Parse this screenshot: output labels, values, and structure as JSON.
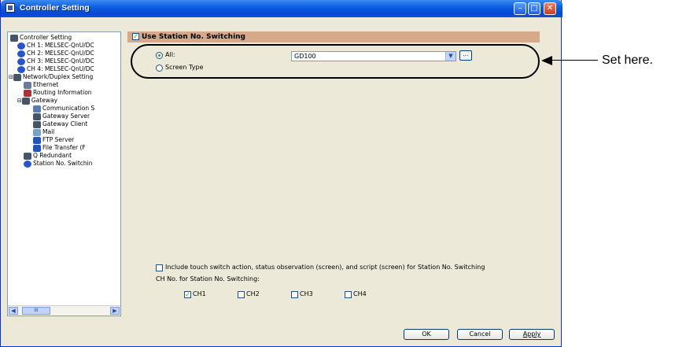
{
  "window": {
    "title": "Controller Setting"
  },
  "tree": {
    "items": [
      {
        "label": "Controller Setting",
        "color": "#445566"
      },
      {
        "label": "CH 1: MELSEC-QnU/DC",
        "color": "#2a55c8"
      },
      {
        "label": "CH 2: MELSEC-QnU/DC",
        "color": "#2a55c8"
      },
      {
        "label": "CH 3: MELSEC-QnU/DC",
        "color": "#2a55c8"
      },
      {
        "label": "CH 4: MELSEC-QnU/DC",
        "color": "#2a55c8"
      },
      {
        "label": "Network/Duplex Setting",
        "color": "#445566"
      },
      {
        "label": "Ethernet",
        "color": "#6a7a9a"
      },
      {
        "label": "Routing Information",
        "color": "#a33"
      },
      {
        "label": "Gateway",
        "color": "#445566"
      },
      {
        "label": "Communication S",
        "color": "#5a7bb0"
      },
      {
        "label": "Gateway Server",
        "color": "#445566"
      },
      {
        "label": "Gateway Client",
        "color": "#445566"
      },
      {
        "label": "Mail",
        "color": "#7aa0c8"
      },
      {
        "label": "FTP Server",
        "color": "#2255bb"
      },
      {
        "label": "File Transfer (F",
        "color": "#2255bb"
      },
      {
        "label": "Q Redundant",
        "color": "#445566"
      },
      {
        "label": "Station No. Switchin",
        "color": "#2a55c8"
      }
    ],
    "scroll_thumb_label": "III"
  },
  "section": {
    "header": "Use Station No. Switching",
    "all_label": "All:",
    "screen_type_label": "Screen Type",
    "combo_value": "GD100",
    "browse_label": "...",
    "include_label": "Include touch switch action, status observation (screen), and script (screen) for Station No. Switching",
    "ch_no_label": "CH No. for Station No. Switching:",
    "channels": [
      {
        "label": "CH1",
        "checked": true
      },
      {
        "label": "CH2",
        "checked": false
      },
      {
        "label": "CH3",
        "checked": false
      },
      {
        "label": "CH4",
        "checked": false
      }
    ]
  },
  "buttons": {
    "ok": "OK",
    "cancel": "Cancel",
    "apply": "Apply"
  },
  "annotation": {
    "text": "Set here."
  }
}
